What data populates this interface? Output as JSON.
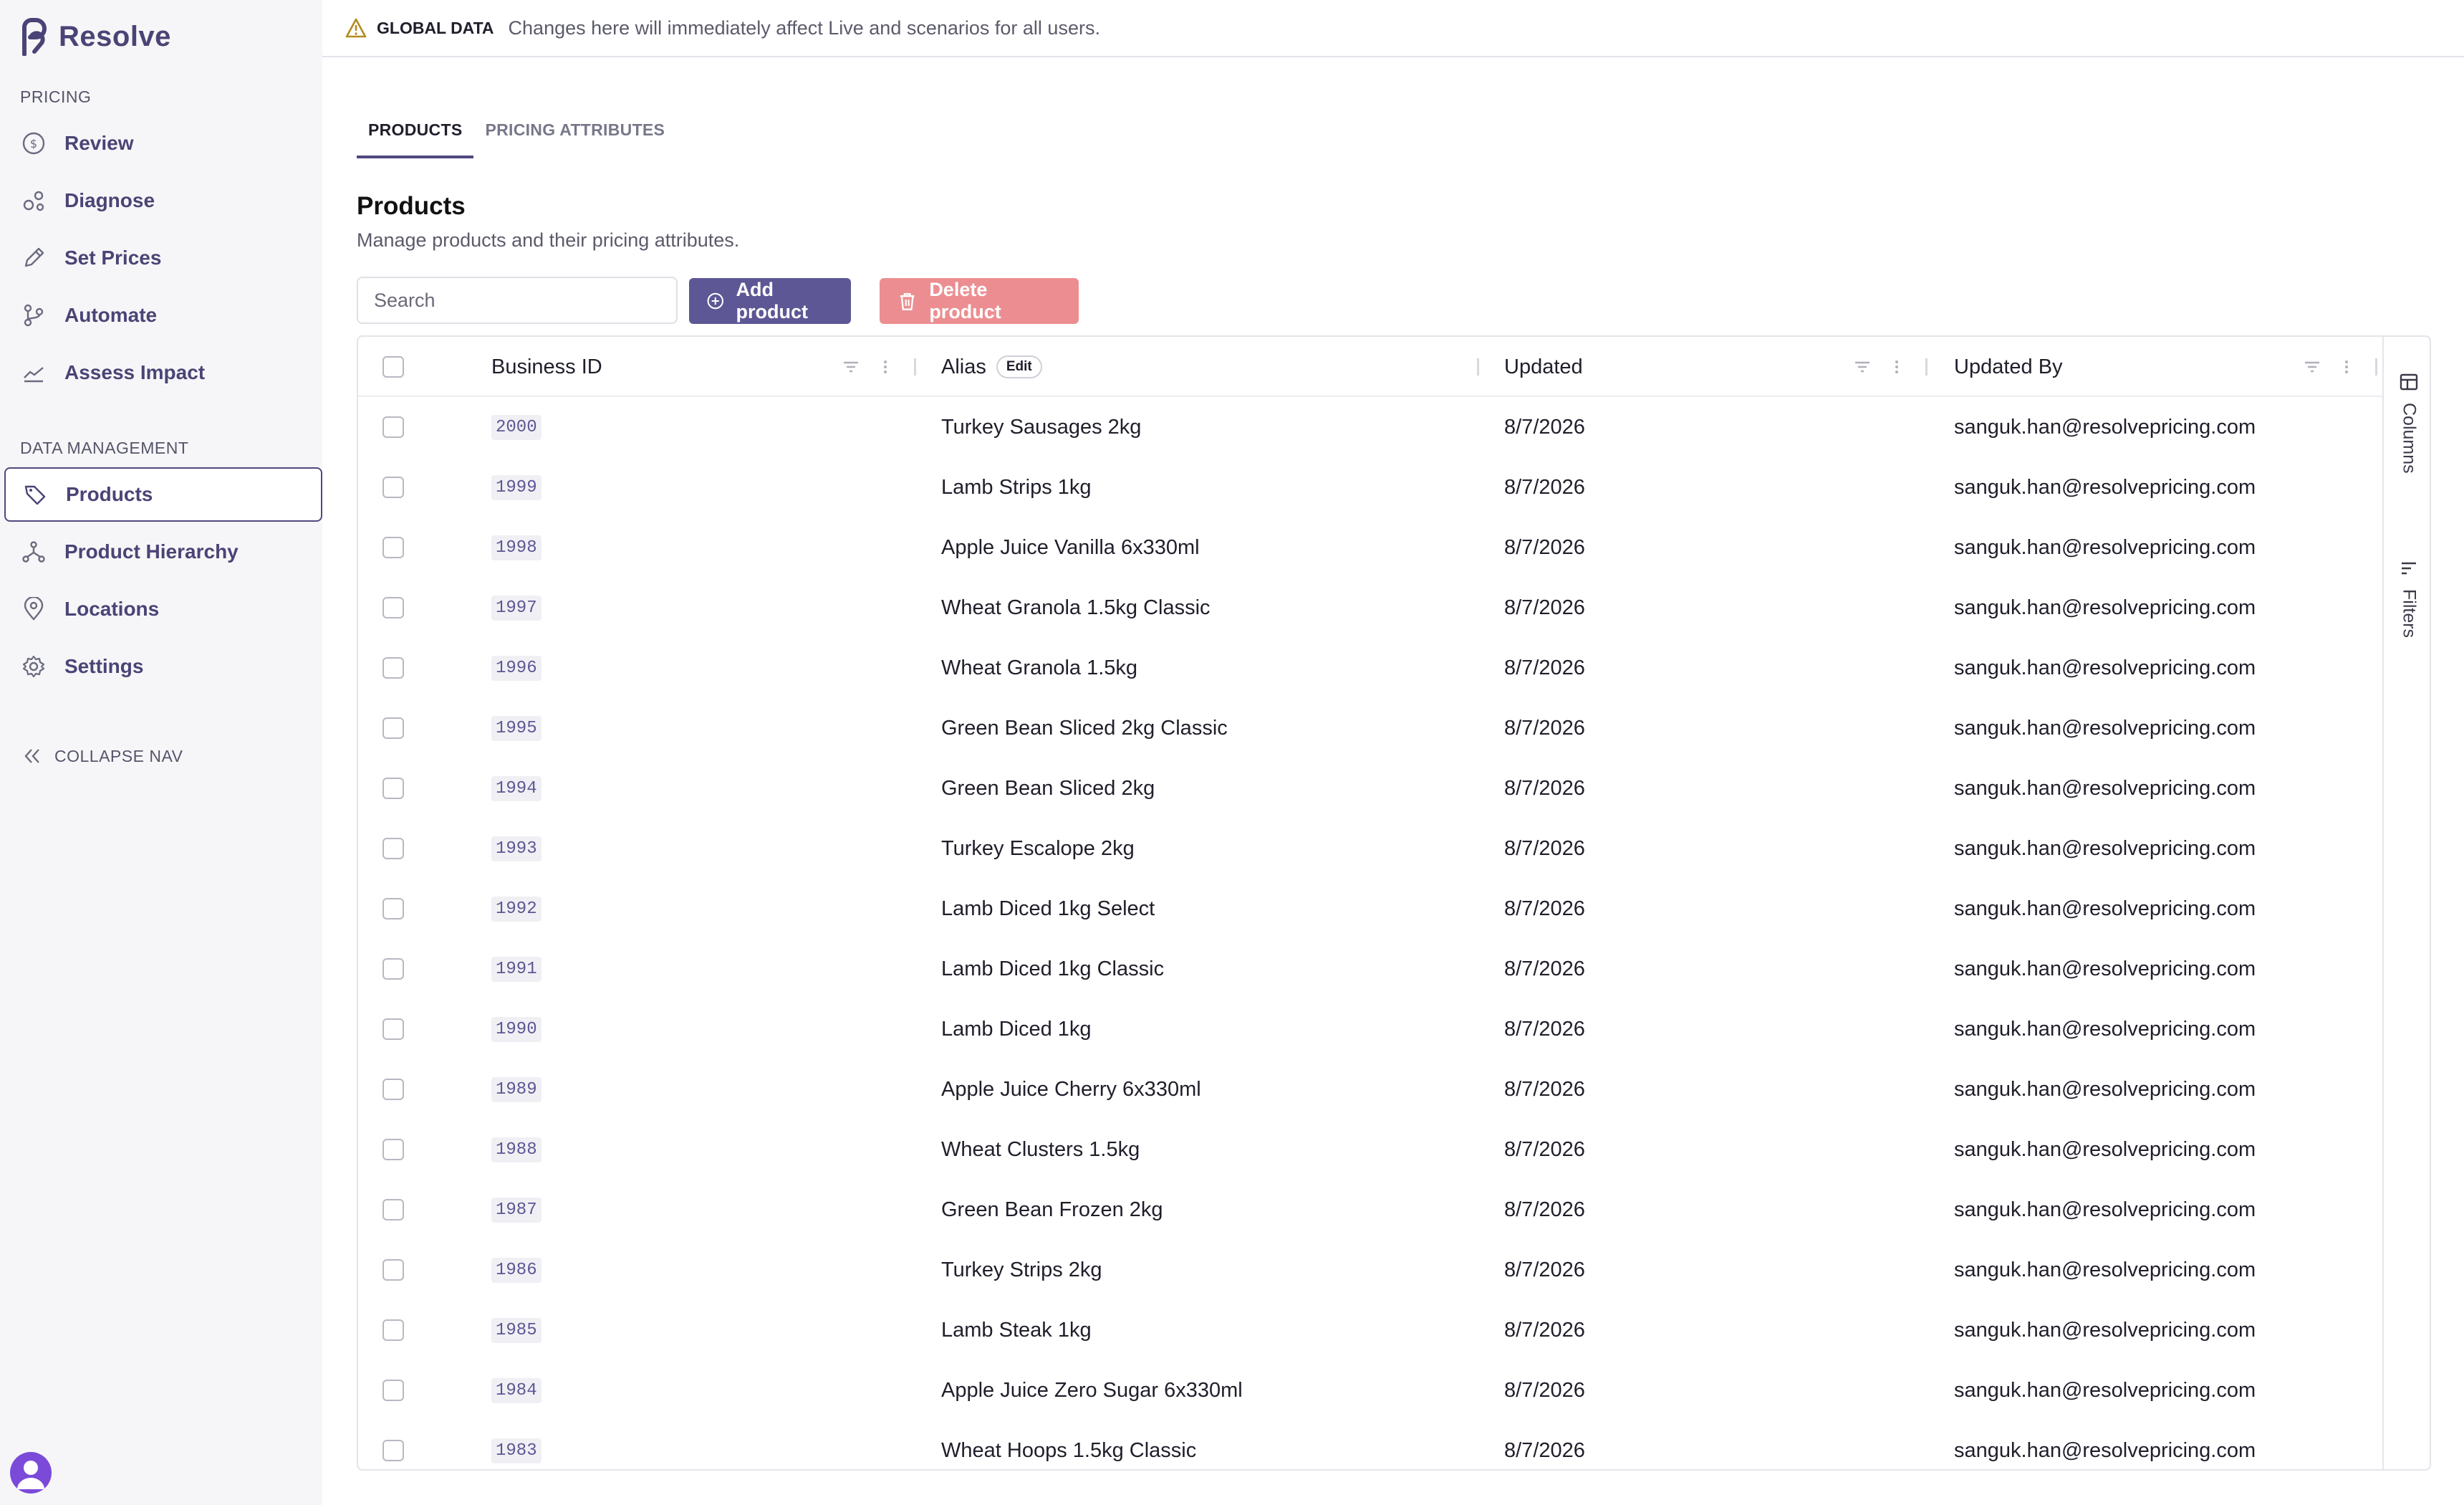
{
  "app": {
    "name": "Resolve"
  },
  "sidebar": {
    "pricing_label": "PRICING",
    "pricing_items": [
      {
        "label": "Review",
        "icon": "dollar-circle-icon"
      },
      {
        "label": "Diagnose",
        "icon": "diagnose-icon"
      },
      {
        "label": "Set Prices",
        "icon": "pencil-icon"
      },
      {
        "label": "Automate",
        "icon": "branch-icon"
      },
      {
        "label": "Assess Impact",
        "icon": "trend-icon"
      }
    ],
    "data_label": "DATA MANAGEMENT",
    "data_items": [
      {
        "label": "Products",
        "icon": "tag-icon",
        "active": true
      },
      {
        "label": "Product Hierarchy",
        "icon": "hierarchy-icon"
      },
      {
        "label": "Locations",
        "icon": "location-pin-icon"
      },
      {
        "label": "Settings",
        "icon": "gear-icon"
      }
    ],
    "collapse_label": "COLLAPSE NAV"
  },
  "banner": {
    "title": "GLOBAL DATA",
    "message": "Changes here will immediately affect Live and scenarios for all users."
  },
  "tabs": [
    {
      "label": "PRODUCTS",
      "active": true
    },
    {
      "label": "PRICING ATTRIBUTES",
      "active": false
    }
  ],
  "page": {
    "title": "Products",
    "subtitle": "Manage products and their pricing attributes."
  },
  "toolbar": {
    "search_placeholder": "Search",
    "add_label": "Add product",
    "delete_label": "Delete product"
  },
  "grid": {
    "columns": {
      "business_id": "Business ID",
      "alias": "Alias",
      "alias_badge": "Edit",
      "updated": "Updated",
      "updated_by": "Updated By"
    },
    "rows": [
      {
        "id": "2000",
        "alias": "Turkey Sausages 2kg",
        "updated": "8/7/2026",
        "by": "sanguk.han@resolvepricing.com"
      },
      {
        "id": "1999",
        "alias": "Lamb Strips 1kg",
        "updated": "8/7/2026",
        "by": "sanguk.han@resolvepricing.com"
      },
      {
        "id": "1998",
        "alias": "Apple Juice Vanilla 6x330ml",
        "updated": "8/7/2026",
        "by": "sanguk.han@resolvepricing.com"
      },
      {
        "id": "1997",
        "alias": "Wheat Granola 1.5kg Classic",
        "updated": "8/7/2026",
        "by": "sanguk.han@resolvepricing.com"
      },
      {
        "id": "1996",
        "alias": "Wheat Granola 1.5kg",
        "updated": "8/7/2026",
        "by": "sanguk.han@resolvepricing.com"
      },
      {
        "id": "1995",
        "alias": "Green Bean Sliced 2kg Classic",
        "updated": "8/7/2026",
        "by": "sanguk.han@resolvepricing.com"
      },
      {
        "id": "1994",
        "alias": "Green Bean Sliced 2kg",
        "updated": "8/7/2026",
        "by": "sanguk.han@resolvepricing.com"
      },
      {
        "id": "1993",
        "alias": "Turkey Escalope 2kg",
        "updated": "8/7/2026",
        "by": "sanguk.han@resolvepricing.com"
      },
      {
        "id": "1992",
        "alias": "Lamb Diced 1kg Select",
        "updated": "8/7/2026",
        "by": "sanguk.han@resolvepricing.com"
      },
      {
        "id": "1991",
        "alias": "Lamb Diced 1kg Classic",
        "updated": "8/7/2026",
        "by": "sanguk.han@resolvepricing.com"
      },
      {
        "id": "1990",
        "alias": "Lamb Diced 1kg",
        "updated": "8/7/2026",
        "by": "sanguk.han@resolvepricing.com"
      },
      {
        "id": "1989",
        "alias": "Apple Juice Cherry 6x330ml",
        "updated": "8/7/2026",
        "by": "sanguk.han@resolvepricing.com"
      },
      {
        "id": "1988",
        "alias": "Wheat Clusters 1.5kg",
        "updated": "8/7/2026",
        "by": "sanguk.han@resolvepricing.com"
      },
      {
        "id": "1987",
        "alias": "Green Bean Frozen 2kg",
        "updated": "8/7/2026",
        "by": "sanguk.han@resolvepricing.com"
      },
      {
        "id": "1986",
        "alias": "Turkey Strips 2kg",
        "updated": "8/7/2026",
        "by": "sanguk.han@resolvepricing.com"
      },
      {
        "id": "1985",
        "alias": "Lamb Steak 1kg",
        "updated": "8/7/2026",
        "by": "sanguk.han@resolvepricing.com"
      },
      {
        "id": "1984",
        "alias": "Apple Juice Zero Sugar 6x330ml",
        "updated": "8/7/2026",
        "by": "sanguk.han@resolvepricing.com"
      },
      {
        "id": "1983",
        "alias": "Wheat Hoops 1.5kg Classic",
        "updated": "8/7/2026",
        "by": "sanguk.han@resolvepricing.com"
      }
    ]
  },
  "side_panel": {
    "columns_label": "Columns",
    "filters_label": "Filters"
  },
  "colors": {
    "brand": "#4a4476",
    "accent": "#5d5795",
    "danger": "#ec8e91",
    "warning": "#b58a1e"
  }
}
